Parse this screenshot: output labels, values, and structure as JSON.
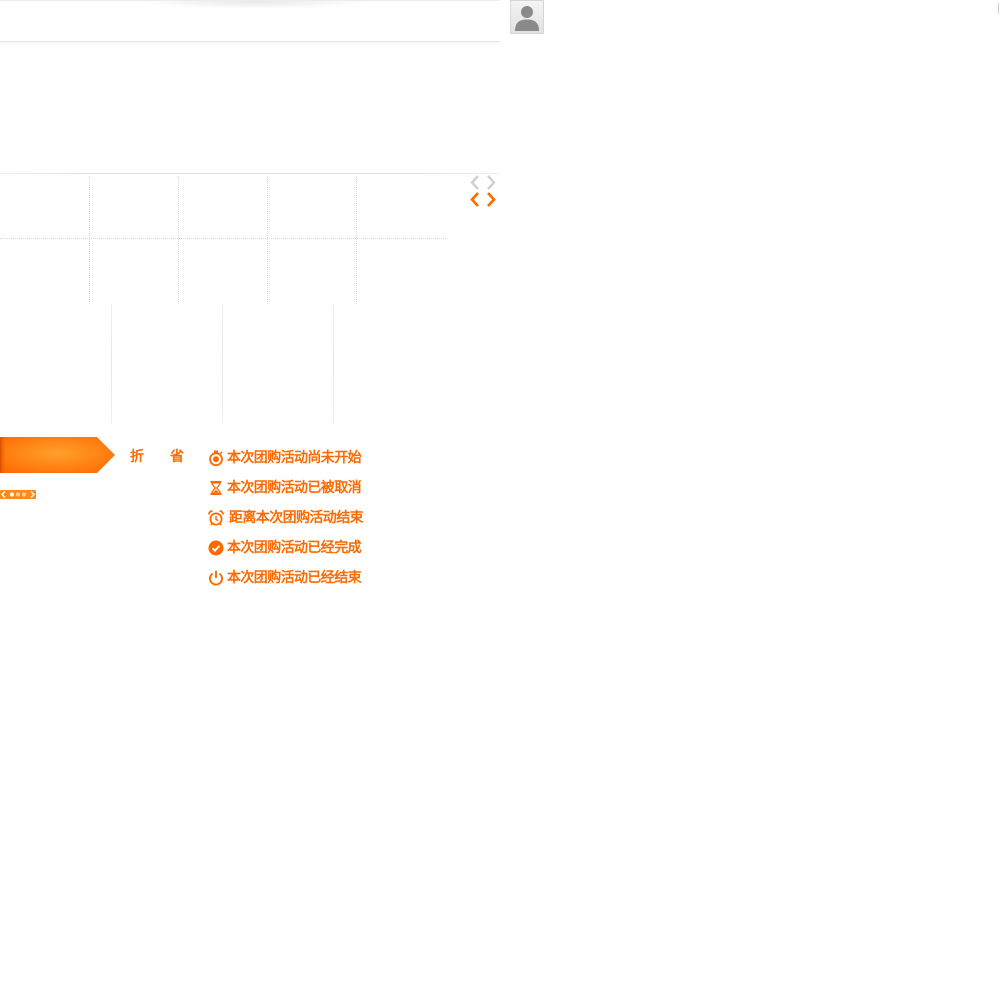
{
  "labels": {
    "discount": "折",
    "save": "省"
  },
  "status_messages": [
    {
      "icon": "stopwatch-icon",
      "text": "本次团购活动尚未开始"
    },
    {
      "icon": "hourglass-icon",
      "text": "本次团购活动已被取消"
    },
    {
      "icon": "alarm-clock-icon",
      "text": "距离本次团购活动结束"
    },
    {
      "icon": "check-circle-icon",
      "text": "本次团购活动已经完成"
    },
    {
      "icon": "power-icon",
      "text": "本次团购活动已经结束"
    }
  ],
  "colors": {
    "accent": "#ff6a00",
    "accent_light": "#ff9a2e",
    "grid_line": "#d8d8d8",
    "arrow_inactive": "#d0d0d0"
  }
}
